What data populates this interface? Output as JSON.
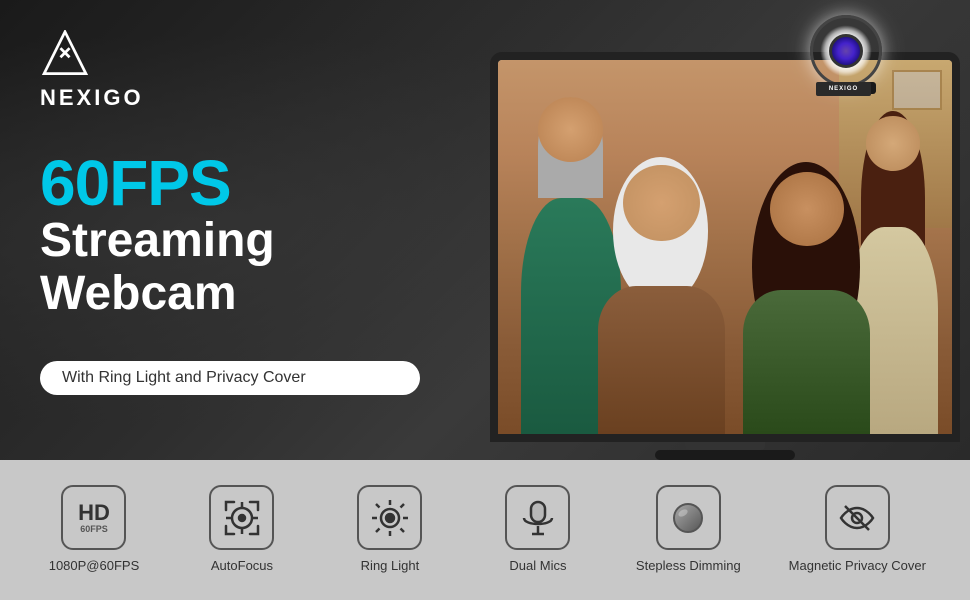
{
  "brand": {
    "name": "NEXIGO",
    "logo_alt": "NexiGo brand logo"
  },
  "hero": {
    "fps_label": "60FPS",
    "line1": "Streaming Webcam",
    "badge_text": "With Ring Light and Privacy Cover",
    "product_alt": "NexiGo 60FPS Streaming Webcam with Ring Light and Privacy Cover"
  },
  "features": [
    {
      "id": "hd-60fps",
      "label": "1080P@60FPS",
      "icon_type": "hd-box"
    },
    {
      "id": "autofocus",
      "label": "AutoFocus",
      "icon_type": "autofocus"
    },
    {
      "id": "ring-light",
      "label": "Ring Light",
      "icon_type": "ring-light"
    },
    {
      "id": "dual-mics",
      "label": "Dual Mics",
      "icon_type": "mic"
    },
    {
      "id": "stepless-dimming",
      "label": "Stepless Dimming",
      "icon_type": "dimming"
    },
    {
      "id": "privacy-cover",
      "label": "Magnetic Privacy\nCover",
      "icon_type": "privacy"
    }
  ]
}
